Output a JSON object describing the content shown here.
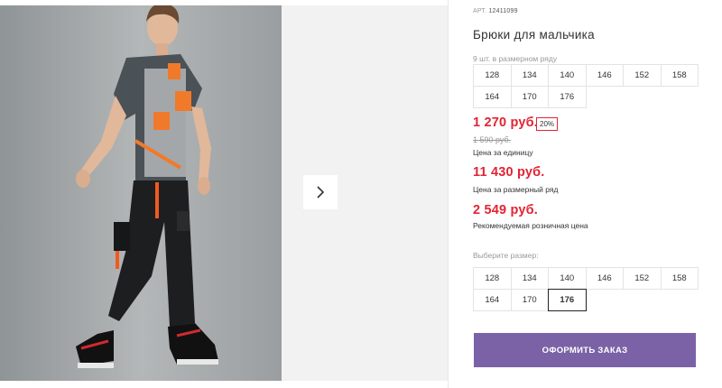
{
  "gallery": {
    "next_icon": "chevron-right-icon"
  },
  "product": {
    "article_label": "АРТ.",
    "article": "12411099",
    "title": "Брюки для мальчика",
    "pack_note": "9 шт. в размерном ряду",
    "pack_sizes": [
      "128",
      "134",
      "140",
      "146",
      "152",
      "158",
      "164",
      "170",
      "176"
    ],
    "price": "1 270 руб.",
    "discount": "20%",
    "old_price": "1 590 руб.",
    "unit_price_label": "Цена за единицу",
    "pack_price": "11 430 руб.",
    "pack_price_label": "Цена за размерный ряд",
    "retail_price": "2 549 руб.",
    "retail_price_label": "Рекомендуемая розничная цена"
  },
  "size_picker": {
    "label": "Выберите размер:",
    "sizes": [
      "128",
      "134",
      "140",
      "146",
      "152",
      "158",
      "164",
      "170",
      "176"
    ],
    "selected": "176"
  },
  "order_button": {
    "label": "ОФОРМИТЬ ЗАКАЗ"
  },
  "colors": {
    "price_red": "#e22433",
    "button_purple": "#7b62a6"
  }
}
